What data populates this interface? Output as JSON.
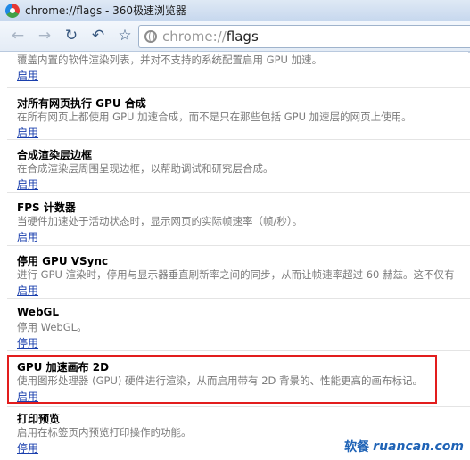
{
  "window": {
    "title": "chrome://flags - 360极速浏览器"
  },
  "toolbar": {
    "back_icon": "back-arrow-icon",
    "forward_icon": "forward-arrow-icon",
    "reload_icon": "reload-icon",
    "undo_icon": "undo-icon",
    "favorite_icon": "star-icon",
    "address": {
      "scheme": "chrome://",
      "path": "flags"
    }
  },
  "flags": [
    {
      "title": "",
      "description": "覆盖内置的软件渲染列表，并对不支持的系统配置启用 GPU 加速。",
      "action": "启用"
    },
    {
      "title": "对所有网页执行 GPU 合成",
      "description": "在所有网页上都使用 GPU 加速合成，而不是只在那些包括 GPU 加速层的网页上使用。",
      "action": "启用"
    },
    {
      "title": "合成渲染层边框",
      "description": "在合成渲染层周围呈现边框，以帮助调试和研究层合成。",
      "action": "启用"
    },
    {
      "title": "FPS 计数器",
      "description": "当硬件加速处于活动状态时，显示网页的实际帧速率（帧/秒）。",
      "action": "启用"
    },
    {
      "title": "停用 GPU VSync",
      "description": "进行 GPU 渲染时，停用与显示器垂直刷新率之间的同步，从而让帧速率超过 60 赫兹。这不仅有",
      "action": "启用"
    },
    {
      "title": "WebGL",
      "description": "停用 WebGL。",
      "action": "停用"
    },
    {
      "title": "GPU 加速画布 2D",
      "description": "使用图形处理器 (GPU) 硬件进行渲染，从而启用带有 2D 背景的、性能更高的画布标记。",
      "action": "启用"
    },
    {
      "title": "打印预览",
      "description": "启用在标签页内预览打印操作的功能。",
      "action": "停用"
    }
  ],
  "highlight_color": "#e21d1d",
  "watermark": {
    "cn": "软餐",
    "en": "ruancan.com"
  }
}
